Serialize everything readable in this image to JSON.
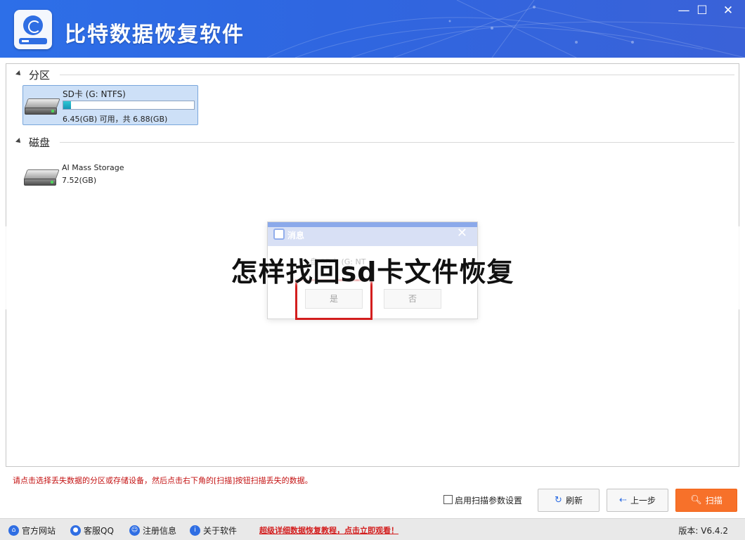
{
  "app": {
    "title": "比特数据恢复软件",
    "window_controls": {
      "minimize": "—",
      "maximize": "☐",
      "close": "✕"
    }
  },
  "groups": [
    {
      "label": "分区",
      "drives": [
        {
          "name": "SD卡 (G: NTFS)",
          "size": "6.45(GB) 可用，共 6.88(GB)",
          "used_fraction": 0.06,
          "selected": true
        }
      ]
    },
    {
      "label": "磁盘",
      "drives": [
        {
          "name": "AI Mass Storage",
          "size": "7.52(GB)"
        }
      ]
    }
  ],
  "dialog": {
    "title": "消息",
    "message": "盘 SD卡 (G: NT",
    "yes": "是",
    "no": "否"
  },
  "overlay_title": "怎样找回sd卡文件恢复",
  "hint": "请点击选择丢失数据的分区或存储设备，然后点击右下角的[扫描]按钮扫描丢失的数据。",
  "scan_params_label": "启用扫描参数设置",
  "buttons": {
    "refresh": "刷新",
    "back": "上一步",
    "scan": "扫描"
  },
  "footer": {
    "links": [
      "官方网站",
      "客服QQ",
      "注册信息",
      "关于软件"
    ],
    "promo": "超级详细数据恢复教程，点击立即观看！",
    "version": "版本: V6.4.2"
  },
  "colors": {
    "titlebar": "#2f66e0",
    "scan_button": "#f7712a",
    "hint_text": "#c41313",
    "selection": "#cde0f7"
  }
}
